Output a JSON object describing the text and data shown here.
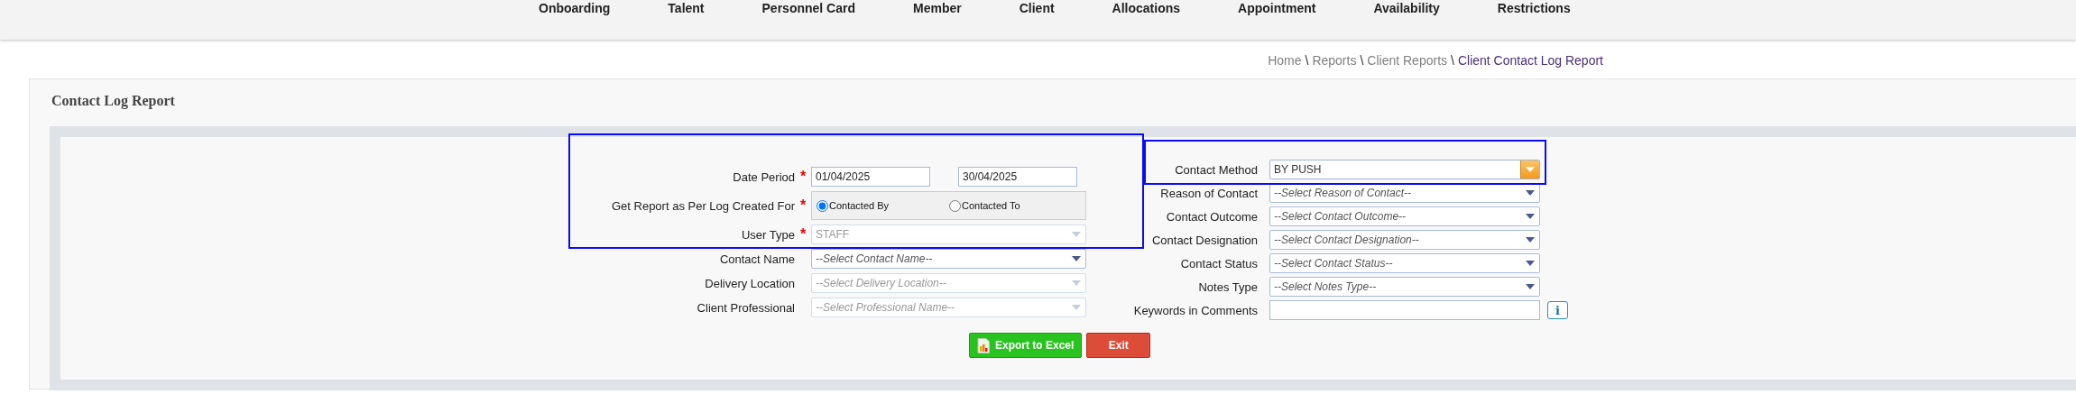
{
  "nav": [
    {
      "label": "Onboarding"
    },
    {
      "label": "Talent"
    },
    {
      "label": "Personnel Card"
    },
    {
      "label": "Member"
    },
    {
      "label": "Client"
    },
    {
      "label": "Allocations"
    },
    {
      "label": "Appointment"
    },
    {
      "label": "Availability"
    },
    {
      "label": "Restrictions"
    }
  ],
  "breadcrumb": {
    "separator": "\\",
    "items": [
      {
        "label": "Home",
        "current": false
      },
      {
        "label": "Reports",
        "current": false
      },
      {
        "label": "Client Reports",
        "current": false
      },
      {
        "label": "Client Contact Log Report",
        "current": true
      }
    ]
  },
  "panel": {
    "title": "Contact Log Report"
  },
  "left_fields": [
    {
      "kind": "date_range",
      "label": "Date Period",
      "required_mark": "*",
      "from": "01/04/2025",
      "to": "30/04/2025"
    },
    {
      "kind": "radio",
      "label": "Get Report as Per Log Created For",
      "required_mark": "*",
      "options": [
        {
          "label": "Contacted By",
          "selected": true
        },
        {
          "label": "Contacted To",
          "selected": false
        }
      ]
    },
    {
      "kind": "select",
      "label": "User Type",
      "required_mark": "*",
      "value": "STAFF",
      "disabled": true,
      "focused": false
    },
    {
      "kind": "select",
      "label": "Contact Name",
      "placeholder": "--Select Contact Name--",
      "disabled": false,
      "focused": false
    },
    {
      "kind": "select",
      "label": "Delivery Location",
      "placeholder": "--Select Delivery Location--",
      "disabled": true,
      "focused": false
    },
    {
      "kind": "select",
      "label": "Client Professional",
      "placeholder": "--Select Professional Name--",
      "disabled": true,
      "focused": false
    }
  ],
  "right_fields": [
    {
      "kind": "select",
      "label": "Contact Method",
      "value": "BY PUSH",
      "disabled": false,
      "focused": true
    },
    {
      "kind": "select",
      "label": "Reason of Contact",
      "placeholder": "--Select Reason of Contact--",
      "disabled": false,
      "focused": false
    },
    {
      "kind": "select",
      "label": "Contact Outcome",
      "placeholder": "--Select Contact Outcome--",
      "disabled": false,
      "focused": false
    },
    {
      "kind": "select",
      "label": "Contact Designation",
      "placeholder": "--Select Contact Designation--",
      "disabled": false,
      "focused": false
    },
    {
      "kind": "select",
      "label": "Contact Status",
      "placeholder": "--Select Contact Status--",
      "disabled": false,
      "focused": false
    },
    {
      "kind": "select",
      "label": "Notes Type",
      "placeholder": "--Select Notes Type--",
      "disabled": false,
      "focused": false
    },
    {
      "kind": "text",
      "label": "Keywords in Comments",
      "info_button": "i"
    }
  ],
  "buttons": [
    {
      "label": "Export to Excel",
      "kind": "export"
    },
    {
      "label": "Exit",
      "kind": "exit"
    }
  ],
  "annotations": [
    {
      "kind": "rectangle"
    },
    {
      "kind": "rectangle"
    }
  ]
}
